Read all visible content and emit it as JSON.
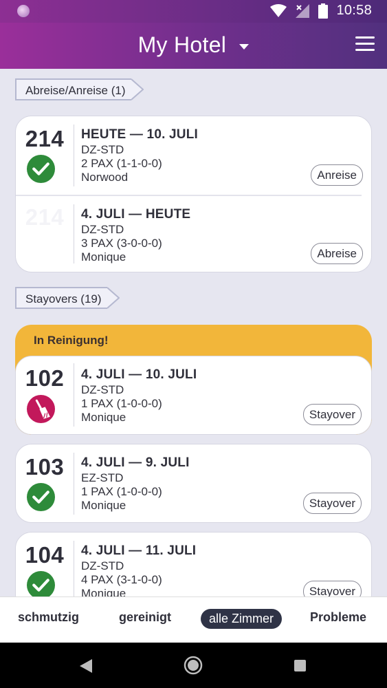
{
  "status_bar": {
    "time": "10:58"
  },
  "app_bar": {
    "title": "My Hotel"
  },
  "sections": {
    "arrivals_departures": "Abreise/Anreise (1)",
    "stayovers": "Stayovers (19)"
  },
  "arrival_card": {
    "rows": [
      {
        "room": "214",
        "dates": "HEUTE — 10. JULI",
        "type": "DZ-STD",
        "pax": "2 PAX (1-1-0-0)",
        "guest": "Norwood",
        "action": "Anreise"
      },
      {
        "room": "214",
        "dates": "4. JULI — HEUTE",
        "type": "DZ-STD",
        "pax": "3 PAX (3-0-0-0)",
        "guest": "Monique",
        "action": "Abreise"
      }
    ]
  },
  "cleaning_banner": {
    "label": "In Reinigung!"
  },
  "stayover_cards": [
    {
      "room": "102",
      "dates": "4. JULI — 10. JULI",
      "type": "DZ-STD",
      "pax": "1 PAX (1-0-0-0)",
      "guest": "Monique",
      "action": "Stayover",
      "status": "cleaning"
    },
    {
      "room": "103",
      "dates": "4. JULI — 9. JULI",
      "type": "EZ-STD",
      "pax": "1 PAX (1-0-0-0)",
      "guest": "Monique",
      "action": "Stayover",
      "status": "clean"
    },
    {
      "room": "104",
      "dates": "4. JULI — 11. JULI",
      "type": "DZ-STD",
      "pax": "4 PAX (3-1-0-0)",
      "guest": "Monique",
      "action": "Stayover",
      "status": "clean"
    }
  ],
  "bottom_tabs": [
    "schmutzig",
    "gereinigt",
    "alle Zimmer",
    "Probleme"
  ],
  "colors": {
    "header_gradient_start": "#9a2f9a",
    "header_gradient_end": "#51307e",
    "clean_green": "#2e8b3a",
    "cleaning_magenta": "#c2185b",
    "banner_yellow": "#f2b63a",
    "active_tab": "#2f3346"
  },
  "icons": [
    "wifi-icon",
    "signal-icon",
    "battery-icon",
    "menu-icon",
    "check-circle-icon",
    "broom-icon",
    "back-icon",
    "home-icon",
    "recents-icon"
  ]
}
